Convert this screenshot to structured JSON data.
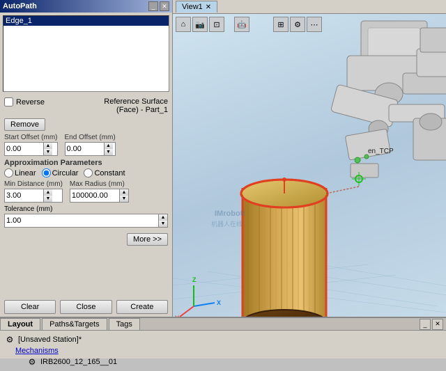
{
  "autopath": {
    "title": "AutoPath",
    "edge_list": [
      "Edge_1"
    ],
    "reverse_label": "Reverse",
    "remove_label": "Remove",
    "reference_surface_label": "Reference Surface",
    "reference_surface_value": "(Face) - Part_1",
    "start_offset_label": "Start Offset (mm)",
    "start_offset_value": "0.00",
    "end_offset_label": "End Offset (mm)",
    "end_offset_value": "0.00",
    "approx_params_label": "Approximation Parameters",
    "linear_label": "Linear",
    "circular_label": "Circular",
    "constant_label": "Constant",
    "min_distance_label": "Min Distance (mm)",
    "min_distance_value": "3.00",
    "max_radius_label": "Max Radius (mm)",
    "max_radius_value": "100000.00",
    "tolerance_label": "Tolerance (mm)",
    "tolerance_value": "1.00",
    "more_label": "More >>",
    "clear_label": "Clear",
    "close_label": "Close",
    "create_label": "Create"
  },
  "viewport": {
    "tab_label": "View1",
    "tcp_label": "en_TCP"
  },
  "bottom_panel": {
    "layout_tab": "Layout",
    "paths_tab": "Paths&Targets",
    "tags_tab": "Tags",
    "station_label": "[Unsaved Station]*",
    "mechanisms_label": "Mechanisms",
    "robot_label": "IRB2600_12_165__01"
  }
}
